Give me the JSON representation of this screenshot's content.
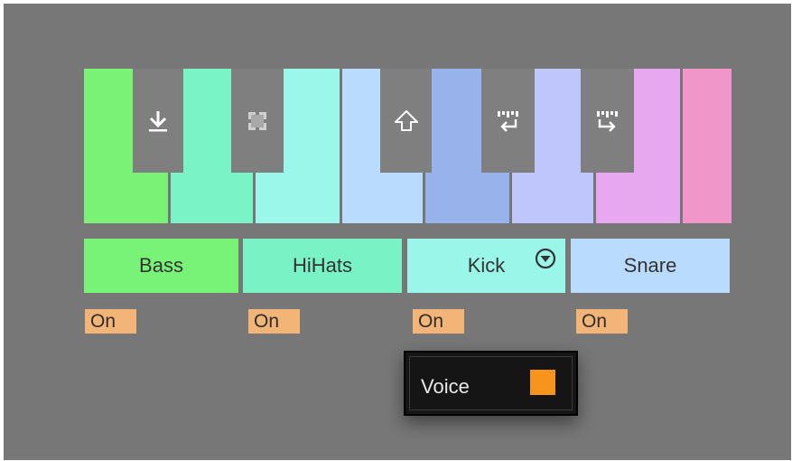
{
  "keyboard": {
    "white_key_colors": [
      "#7af276",
      "#7af4c6",
      "#9af7e9",
      "#b9dcfe",
      "#98b3ec",
      "#bfc6fc",
      "#e8a8f0",
      "#f096c8"
    ],
    "separator_color": "#777777",
    "black_key_color": "#7f7f7f",
    "black_key_icons": [
      "download-arrow-icon",
      "focus-brackets-icon",
      "shift-up-arrow-icon",
      "pattern-left-arrow-icon",
      "pattern-right-arrow-icon"
    ]
  },
  "pads": [
    {
      "label": "Bass",
      "color": "#79f377",
      "status": "On"
    },
    {
      "label": "HiHats",
      "color": "#79f3c6",
      "status": "On"
    },
    {
      "label": "Kick",
      "color": "#9af6e9",
      "status": "On",
      "has_dropdown": true
    },
    {
      "label": "Snare",
      "color": "#b9dcfe"
    }
  ],
  "voice": {
    "label": "Voice",
    "swatch_color": "#f7941d"
  }
}
